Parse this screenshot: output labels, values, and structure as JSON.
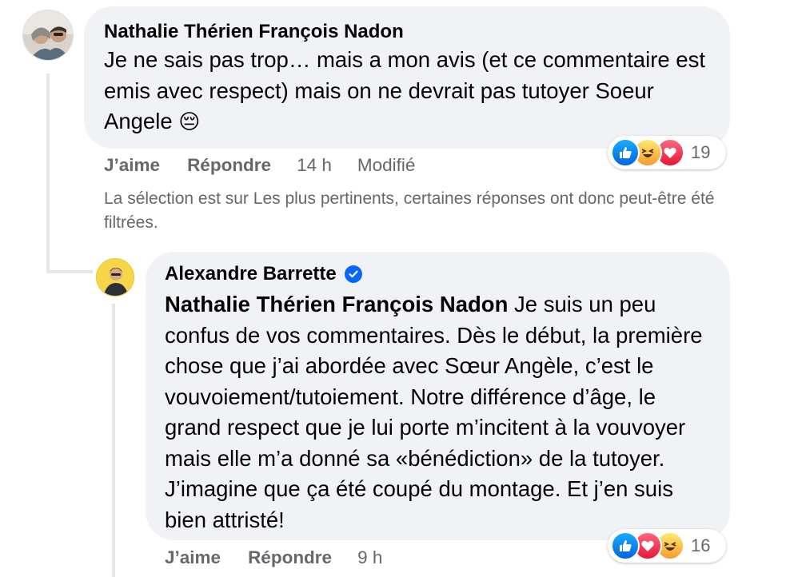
{
  "comment1": {
    "author": "Nathalie Thérien François Nadon",
    "text": "Je ne sais pas trop… mais a mon avis (et ce commentaire est emis avec respect) mais on ne devrait pas tutoyer Soeur Angele",
    "emoji": "😔",
    "actions": {
      "like": "J’aime",
      "reply": "Répondre",
      "time": "14 h",
      "edited": "Modifié"
    },
    "reactions": {
      "icons": [
        "like",
        "haha",
        "love"
      ],
      "count": "19"
    }
  },
  "filter_note": "La sélection est sur Les plus pertinents, certaines réponses ont donc peut-être été filtrées.",
  "reply1": {
    "author": "Alexandre Barrette",
    "verified": true,
    "mention": "Nathalie Thérien François Nadon",
    "text": " Je suis un peu confus de vos commentaires. Dès le début, la première chose que j’ai abordée avec Sœur Angèle, c’est le vouvoiement/tutoiement. Notre différence d’âge, le grand respect que je lui porte m’incitent à la vouvoyer mais elle m’a donné sa «bénédiction» de la tutoyer. J’imagine que ça été coupé du montage. Et j’en suis bien attristé!",
    "actions": {
      "like": "J’aime",
      "reply": "Répondre",
      "time": "9 h"
    },
    "reactions": {
      "icons": [
        "like",
        "love",
        "haha"
      ],
      "count": "16"
    }
  },
  "colors": {
    "bubble": "#f0f2f5",
    "secondary_text": "#65676b",
    "verified": "#0866ff",
    "thread_line": "#e4e6eb"
  }
}
